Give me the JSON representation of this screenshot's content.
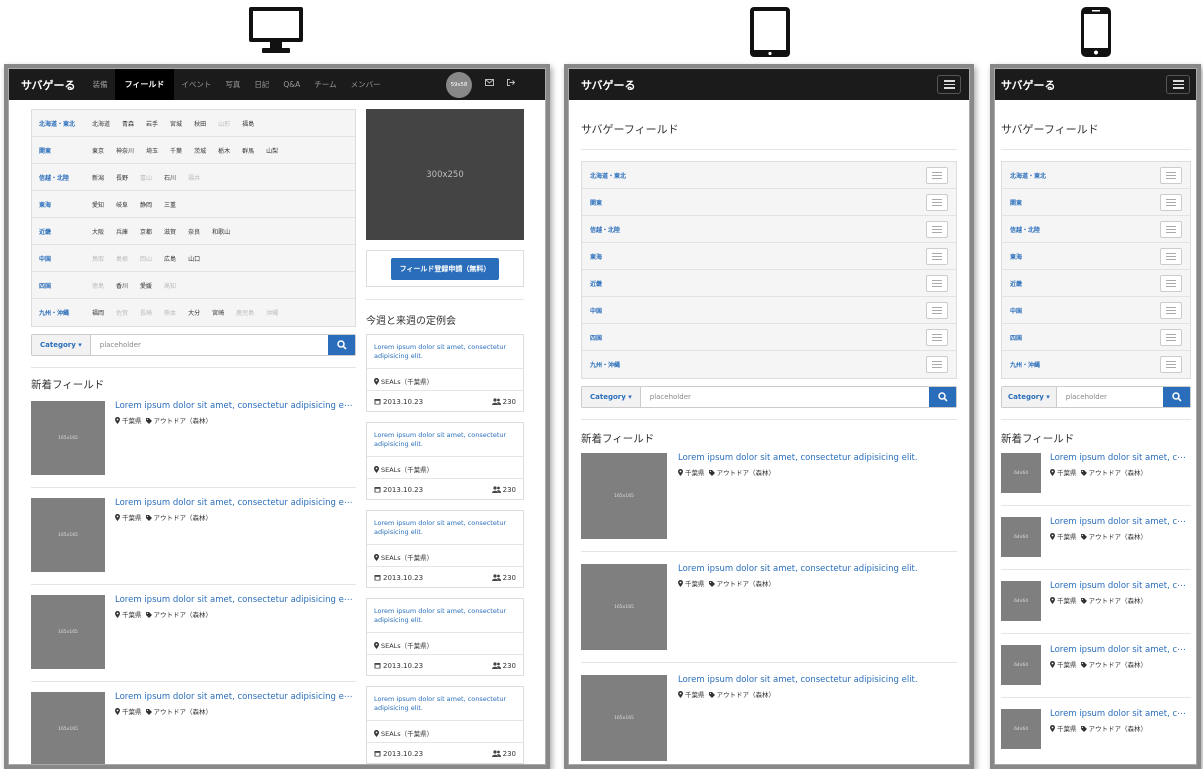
{
  "devices": {
    "desktop_icon": "desktop-monitor-icon",
    "tablet_icon": "tablet-icon",
    "phone_icon": "smartphone-icon"
  },
  "brand": "サバゲーる",
  "nav": {
    "items": [
      "装備",
      "フィールド",
      "イベント",
      "写真",
      "日記",
      "Q&A",
      "チーム",
      "メンバー"
    ],
    "active": "フィールド",
    "clock": "59s58",
    "mail_icon": "envelope-icon",
    "logout_icon": "sign-out-icon",
    "menu_icon": "hamburger-menu-icon"
  },
  "page_title": "サバゲーフィールド",
  "regions": [
    {
      "name": "北海道・東北",
      "prefs": [
        {
          "n": "北海道"
        },
        {
          "n": "青森"
        },
        {
          "n": "岩手"
        },
        {
          "n": "宮城"
        },
        {
          "n": "秋田"
        },
        {
          "n": "山形",
          "off": true
        },
        {
          "n": "福島"
        }
      ]
    },
    {
      "name": "関東",
      "prefs": [
        {
          "n": "東京"
        },
        {
          "n": "神奈川"
        },
        {
          "n": "埼玉"
        },
        {
          "n": "千葉"
        },
        {
          "n": "茨城"
        },
        {
          "n": "栃木"
        },
        {
          "n": "群馬"
        },
        {
          "n": "山梨"
        }
      ]
    },
    {
      "name": "信越・北陸",
      "prefs": [
        {
          "n": "新潟"
        },
        {
          "n": "長野"
        },
        {
          "n": "富山",
          "off": true
        },
        {
          "n": "石川"
        },
        {
          "n": "福井",
          "off": true
        }
      ]
    },
    {
      "name": "東海",
      "prefs": [
        {
          "n": "愛知"
        },
        {
          "n": "岐阜"
        },
        {
          "n": "静岡"
        },
        {
          "n": "三重"
        }
      ]
    },
    {
      "name": "近畿",
      "prefs": [
        {
          "n": "大阪"
        },
        {
          "n": "兵庫"
        },
        {
          "n": "京都"
        },
        {
          "n": "滋賀"
        },
        {
          "n": "奈良"
        },
        {
          "n": "和歌山"
        }
      ]
    },
    {
      "name": "中国",
      "prefs": [
        {
          "n": "鳥取",
          "off": true
        },
        {
          "n": "島根",
          "off": true
        },
        {
          "n": "岡山",
          "off": true
        },
        {
          "n": "広島"
        },
        {
          "n": "山口"
        }
      ]
    },
    {
      "name": "四国",
      "prefs": [
        {
          "n": "徳島",
          "off": true
        },
        {
          "n": "香川"
        },
        {
          "n": "愛媛"
        },
        {
          "n": "高知",
          "off": true
        }
      ]
    },
    {
      "name": "九州・沖縄",
      "prefs": [
        {
          "n": "福岡"
        },
        {
          "n": "佐賀",
          "off": true
        },
        {
          "n": "長崎",
          "off": true
        },
        {
          "n": "熊本",
          "off": true
        },
        {
          "n": "大分"
        },
        {
          "n": "宮崎"
        },
        {
          "n": "鹿児島",
          "off": true
        },
        {
          "n": "沖縄",
          "off": true
        }
      ]
    }
  ],
  "search": {
    "category": "Category ▾",
    "placeholder": "placeholder",
    "button_icon": "search-icon"
  },
  "new_fields": {
    "heading": "新着フィールド",
    "title_desktop": "Lorem ipsum dolor sit amet, consectetur adipisicing e⋯",
    "title_tablet": "Lorem ipsum dolor sit amet, consectetur adipisicing elit.",
    "title_phone": "Lorem ipsum dolor sit amet, c⋯",
    "location": "千葉県",
    "tag": "アウトドア（森林）",
    "thumb_desktop": "165x165",
    "thumb_tablet": "165x165",
    "thumb_phone": "64x64",
    "location_icon": "map-marker-icon",
    "tag_icon": "tag-icon"
  },
  "ad": {
    "label": "300x250"
  },
  "register_button": "フィールド登録申請（無料）",
  "events": {
    "heading": "今週と来週の定例会",
    "items": [
      {
        "title": "Lorem ipsum dolor sit amet, consectetur adipisicing elit.",
        "team": "SEALs（千葉県）",
        "date": "2013.10.23",
        "count": "230"
      },
      {
        "title": "Lorem ipsum dolor sit amet, consectetur adipisicing elit.",
        "team": "SEALs（千葉県）",
        "date": "2013.10.23",
        "count": "230"
      },
      {
        "title": "Lorem ipsum dolor sit amet, consectetur adipisicing elit.",
        "team": "SEALs（千葉県）",
        "date": "2013.10.23",
        "count": "230"
      },
      {
        "title": "Lorem ipsum dolor sit amet, consectetur adipisicing elit.",
        "team": "SEALs（千葉県）",
        "date": "2013.10.23",
        "count": "230"
      },
      {
        "title": "Lorem ipsum dolor sit amet, consectetur adipisicing elit.",
        "team": "SEALs（千葉県）",
        "date": "2013.10.23",
        "count": "230"
      }
    ]
  }
}
